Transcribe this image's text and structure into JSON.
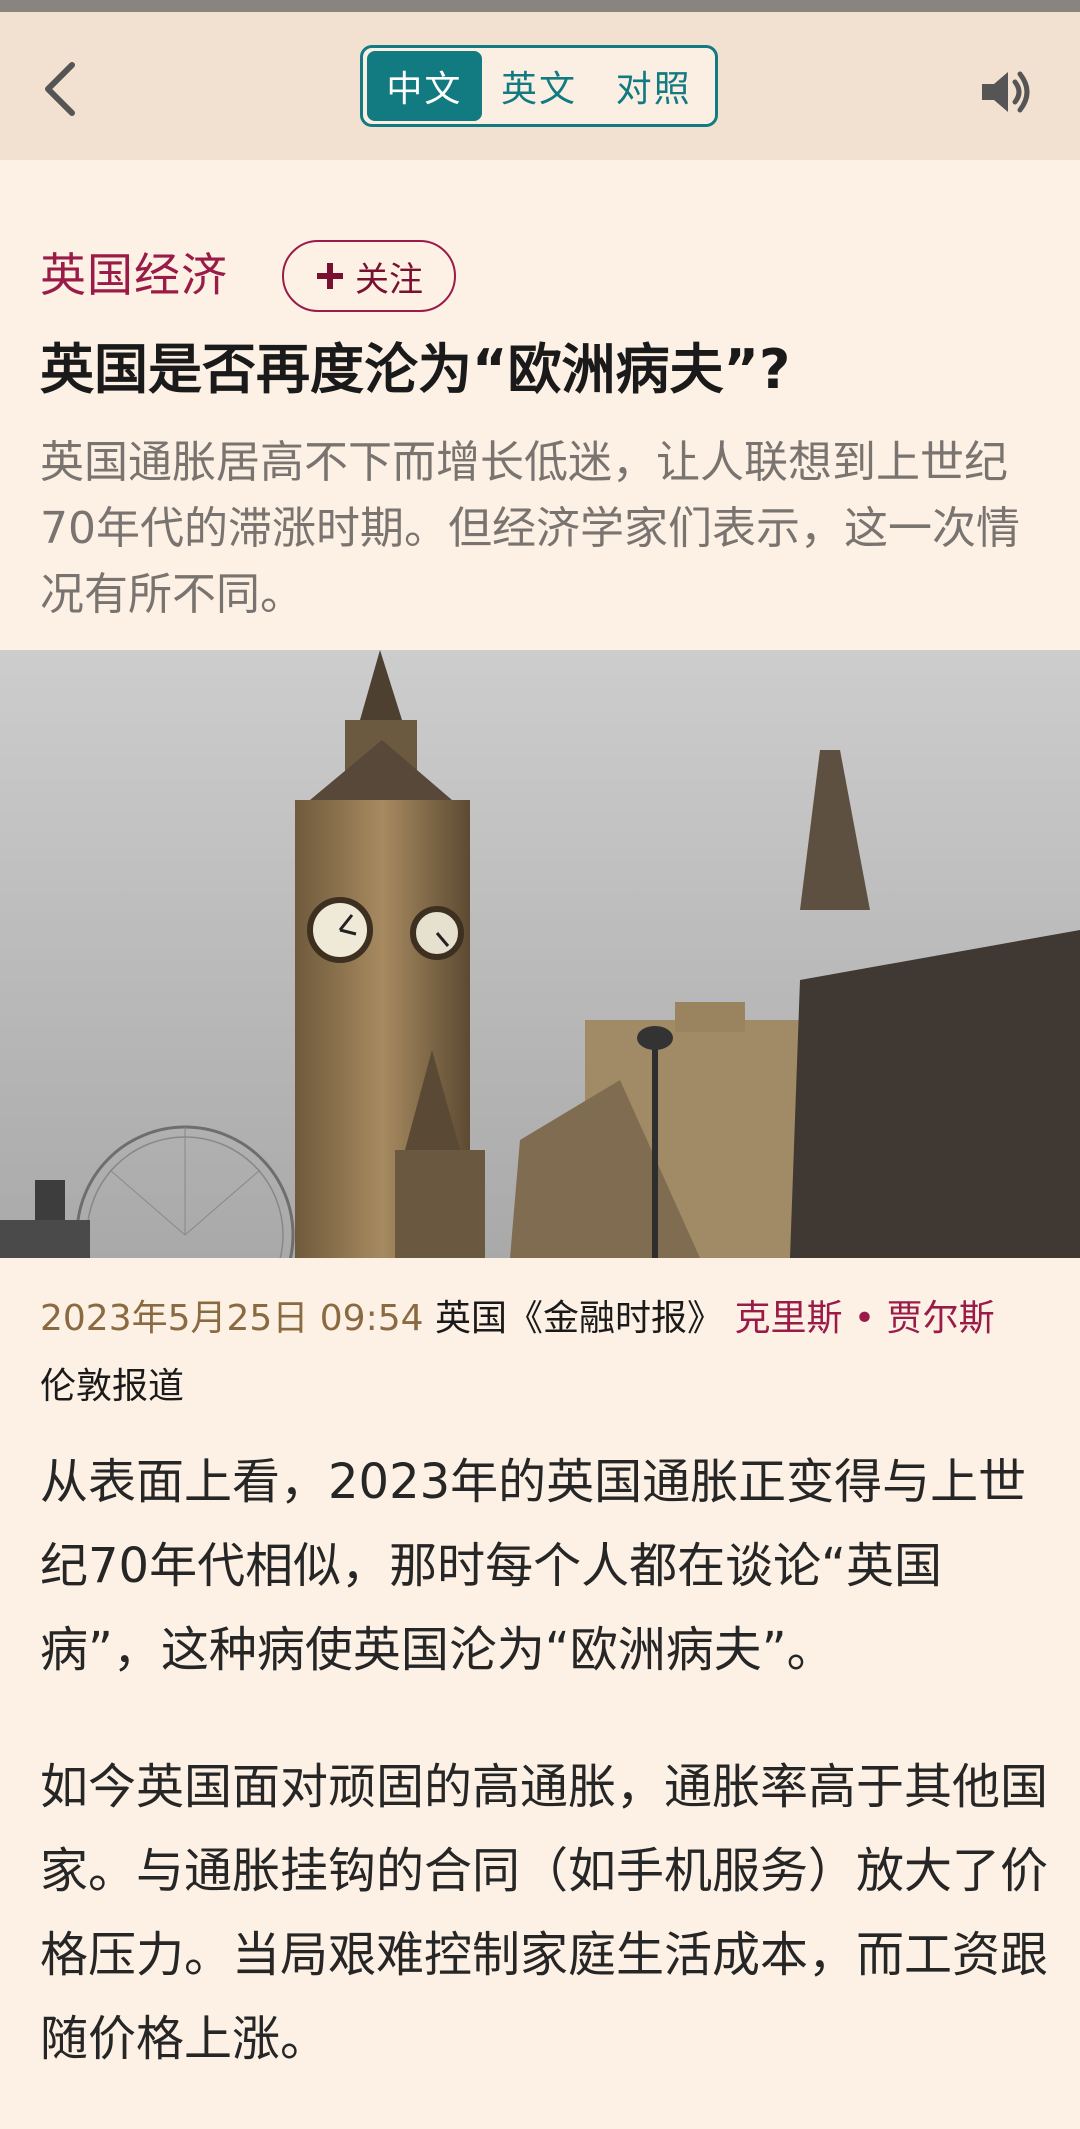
{
  "header": {
    "lang_options": [
      "中文",
      "英文",
      "对照"
    ],
    "active_lang": 0
  },
  "article": {
    "section": "英国经济",
    "follow_label": "关注",
    "title": "英国是否再度沦为“欧洲病夫”?",
    "standfirst": "英国通胀居高不下而增长低迷，让人联想到上世纪70年代的滞涨时期。但经济学家们表示，这一次情况有所不同。",
    "date": "2023年5月25日 09:54",
    "source": "英国《金融时报》",
    "author": "克里斯 • 贾尔斯",
    "location": "伦敦报道",
    "paragraphs": [
      "从表面上看，2023年的英国通胀正变得与上世纪70年代相似，那时每个人都在谈论“英国病”，这种病使英国沦为“欧洲病夫”。",
      "如今英国面对顽固的高通胀，通胀率高于其他国家。与通胀挂钩的合同（如手机服务）放大了价格压力。当局艰难控制家庭生活成本，而工资跟随价格上涨。"
    ]
  },
  "icons": {
    "back": "chevron-left-icon",
    "audio": "speaker-icon",
    "follow": "plus-icon"
  },
  "colors": {
    "accent": "#127a81",
    "section": "#9a1a48",
    "background": "#fdf1e5"
  }
}
